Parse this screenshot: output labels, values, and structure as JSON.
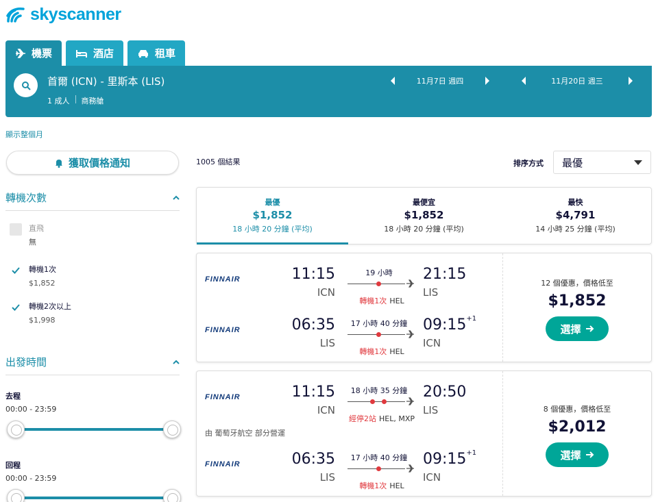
{
  "brand": {
    "name": "skyscanner",
    "icon": "skyscanner-cloud-icon",
    "color": "#00a3da"
  },
  "colors": {
    "primary": "#1c8ea8",
    "tab": "#22a7c4",
    "stop_red": "#e0393e",
    "button_green": "#00a698"
  },
  "tabs": [
    {
      "label": "機票",
      "icon": "plane-icon",
      "active": true
    },
    {
      "label": "酒店",
      "icon": "bed-icon"
    },
    {
      "label": "租車",
      "icon": "car-icon"
    }
  ],
  "search": {
    "route": "首爾 (ICN) - 里斯本 (LIS)",
    "passengers": "1 成人",
    "cabin": "商務艙",
    "depart_date": "11月7日 週四",
    "return_date": "11月20日 週三"
  },
  "month_link": "顯示整個月",
  "alert_button": "獲取價格通知",
  "filters": {
    "stops_title": "轉機次數",
    "stops": [
      {
        "label": "直飛",
        "price": "無",
        "checked": false,
        "disabled": true
      },
      {
        "label": "轉機1次",
        "price": "$1,852",
        "checked": true
      },
      {
        "label": "轉機2次以上",
        "price": "$1,998",
        "checked": true
      }
    ],
    "time_title": "出發時間",
    "outbound_label": "去程",
    "outbound_range": "00:00 - 23:59",
    "return_label": "回程",
    "return_range": "00:00 - 23:59"
  },
  "results": {
    "count": "1005 個結果",
    "sort_label": "排序方式",
    "sort_value": "最優"
  },
  "sort_tabs": [
    {
      "title": "最優",
      "price": "$1,852",
      "duration": "18 小時 20 分鐘 (平均)",
      "active": true
    },
    {
      "title": "最便宜",
      "price": "$1,852",
      "duration": "18 小時 20 分鐘 (平均)"
    },
    {
      "title": "最快",
      "price": "$4,791",
      "duration": "14 小時 25 分鐘 (平均)"
    }
  ],
  "itineraries": [
    {
      "deals": "12 個優惠，價格低至",
      "price": "$1,852",
      "select_label": "選擇",
      "legs": [
        {
          "airline": "FINNAIR",
          "dep_time": "11:15",
          "dep_airport": "ICN",
          "duration": "19 小時",
          "arr_time": "21:15",
          "arr_plus": "",
          "arr_airport": "LIS",
          "stops": "轉機1次",
          "stop_airports": "HEL"
        },
        {
          "airline": "FINNAIR",
          "dep_time": "06:35",
          "dep_airport": "LIS",
          "duration": "17 小時 40 分鐘",
          "arr_time": "09:15",
          "arr_plus": "+1",
          "arr_airport": "ICN",
          "stops": "轉機1次",
          "stop_airports": "HEL"
        }
      ]
    },
    {
      "deals": "8 個優惠，價格低至",
      "price": "$2,012",
      "select_label": "選擇",
      "operated_by": "由 葡萄牙航空 部分營運",
      "legs": [
        {
          "airline": "FINNAIR",
          "dep_time": "11:15",
          "dep_airport": "ICN",
          "duration": "18 小時 35 分鐘",
          "arr_time": "20:50",
          "arr_plus": "",
          "arr_airport": "LIS",
          "stops": "經停2站",
          "stop_airports": "HEL, MXP"
        },
        {
          "airline": "FINNAIR",
          "dep_time": "06:35",
          "dep_airport": "LIS",
          "duration": "17 小時 40 分鐘",
          "arr_time": "09:15",
          "arr_plus": "+1",
          "arr_airport": "ICN",
          "stops": "轉機1次",
          "stop_airports": "HEL"
        }
      ]
    }
  ]
}
